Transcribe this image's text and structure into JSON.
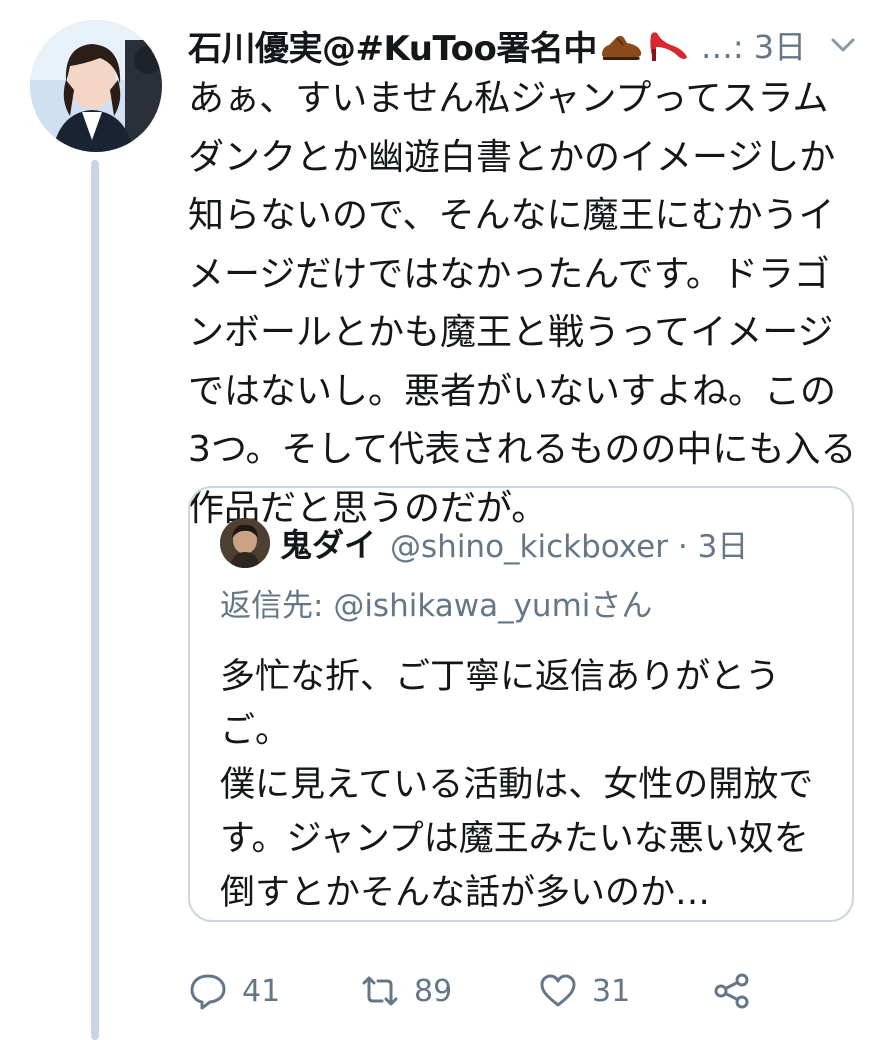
{
  "tweet": {
    "display_name": "石川優実@#KuToo署名中",
    "emoji_icons": [
      "mans-shoe-icon",
      "high-heel-icon"
    ],
    "meta": "…: 3日",
    "text": "あぁ、すいません私ジャンプってスラムダンクとか幽遊白書とかのイメージしか知らないので、そんなに魔王にむかうイメージだけではなかったんです。ドラゴンボールとかも魔王と戦うってイメージではないし。悪者がいないすよね。この3つ。そして代表されるものの中にも入る作品だと思うのだが。"
  },
  "quote": {
    "name": "鬼ダイ",
    "handle_time": "@shino_kickboxer · 3日",
    "reply_prefix": "返信先: ",
    "reply_mention": "@ishikawa_yumi",
    "reply_suffix": "さん",
    "text": "多忙な折、ご丁寧に返信ありがとうご。\n僕に見えている活動は、女性の開放です。ジャンプは魔王みたいな悪い奴を倒すとかそんな話が多いのか…"
  },
  "actions": {
    "reply_count": "41",
    "retweet_count": "89",
    "like_count": "31"
  },
  "colors": {
    "text": "#14171a",
    "secondary": "#657786",
    "border": "#ccd6dd",
    "thread_line": "#c8d6e4"
  }
}
